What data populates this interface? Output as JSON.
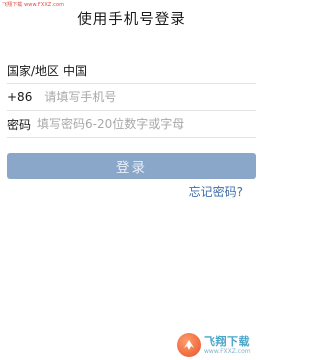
{
  "watermark_top": "飞翔下载 www.FXXZ.com",
  "title": "使用手机号登录",
  "region": {
    "label": "国家/地区",
    "value": "中国"
  },
  "phone": {
    "prefix": "+86",
    "placeholder": "请填写手机号"
  },
  "password": {
    "label": "密码",
    "placeholder": "填写密码6-20位数字或字母"
  },
  "login_label": "登录",
  "forgot_label": "忘记密码?",
  "brand": {
    "main": "飞翔下载",
    "sub": "www.FXXZ.com"
  },
  "colors": {
    "button": "#8aa7c9",
    "link": "#3d6fa8",
    "brand": "#e7522b"
  }
}
